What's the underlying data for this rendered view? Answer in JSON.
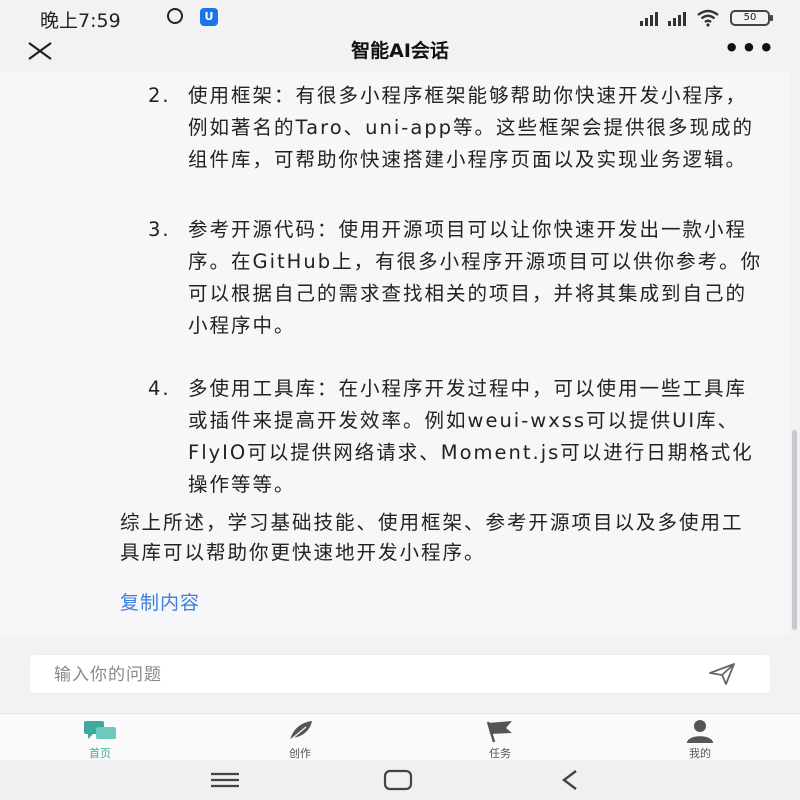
{
  "status": {
    "time": "晚上7:59",
    "shield_glyph": "U",
    "battery": "50"
  },
  "nav": {
    "title": "智能AI会话",
    "more": "•••"
  },
  "answer": {
    "items": [
      {
        "num": "2.",
        "text": "使用框架：有很多小程序框架能够帮助你快速开发小程序，例如著名的Taro、uni-app等。这些框架会提供很多现成的组件库，可帮助你快速搭建小程序页面以及实现业务逻辑。"
      },
      {
        "num": "3.",
        "text": "参考开源代码：使用开源项目可以让你快速开发出一款小程序。在GitHub上，有很多小程序开源项目可以供你参考。你可以根据自己的需求查找相关的项目，并将其集成到自己的小程序中。"
      },
      {
        "num": "4.",
        "text": "多使用工具库：在小程序开发过程中，可以使用一些工具库或插件来提高开发效率。例如weui-wxss可以提供UI库、FlyIO可以提供网络请求、Moment.js可以进行日期格式化操作等等。"
      }
    ],
    "summary": "综上所述，学习基础技能、使用框架、参考开源项目以及多使用工具库可以帮助你更快速地开发小程序。",
    "copy_label": "复制内容"
  },
  "input": {
    "placeholder": "输入你的问题",
    "value": ""
  },
  "tabs": [
    {
      "label": "首页",
      "icon": "chat-bubbles-icon",
      "active": true
    },
    {
      "label": "创作",
      "icon": "feather-icon",
      "active": false
    },
    {
      "label": "任务",
      "icon": "flag-icon",
      "active": false
    },
    {
      "label": "我的",
      "icon": "person-icon",
      "active": false
    }
  ],
  "colors": {
    "accent": "#3ea89b",
    "link": "#3b7fd9",
    "background": "#f2f2f4"
  }
}
